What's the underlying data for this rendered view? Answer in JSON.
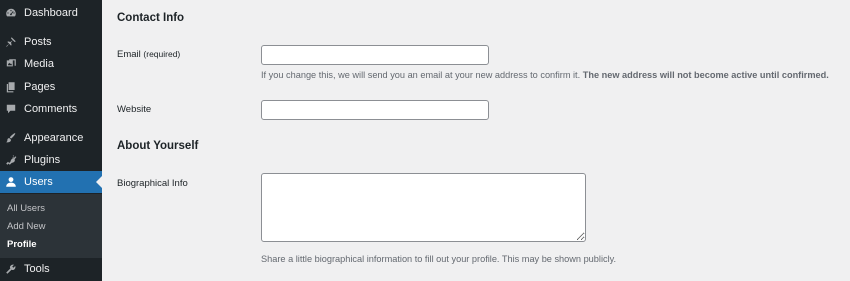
{
  "sidebar": {
    "items": [
      {
        "label": "Dashboard",
        "icon": "dashboard-icon"
      },
      {
        "label": "Posts",
        "icon": "pushpin-icon"
      },
      {
        "label": "Media",
        "icon": "media-icon"
      },
      {
        "label": "Pages",
        "icon": "pages-icon"
      },
      {
        "label": "Comments",
        "icon": "comment-icon"
      },
      {
        "label": "Appearance",
        "icon": "paintbrush-icon"
      },
      {
        "label": "Plugins",
        "icon": "plugin-icon"
      },
      {
        "label": "Users",
        "icon": "user-icon"
      },
      {
        "label": "Tools",
        "icon": "wrench-icon"
      }
    ],
    "submenu": [
      "All Users",
      "Add New",
      "Profile"
    ],
    "active_item": "Users",
    "active_subitem": "Profile"
  },
  "contact": {
    "title": "Contact Info",
    "email_label": "Email",
    "email_required": "(required)",
    "email_value": "",
    "email_desc_normal": "If you change this, we will send you an email at your new address to confirm it.",
    "email_desc_bold": "The new address will not become active until confirmed.",
    "website_label": "Website",
    "website_value": ""
  },
  "about": {
    "title": "About Yourself",
    "bio_label": "Biographical Info",
    "bio_value": "",
    "bio_desc": "Share a little biographical information to fill out your profile. This may be shown publicly."
  },
  "colors": {
    "sidebar_bg": "#1d2327",
    "submenu_bg": "#2c3338",
    "accent": "#2271b1",
    "page_bg": "#f0f0f1"
  }
}
